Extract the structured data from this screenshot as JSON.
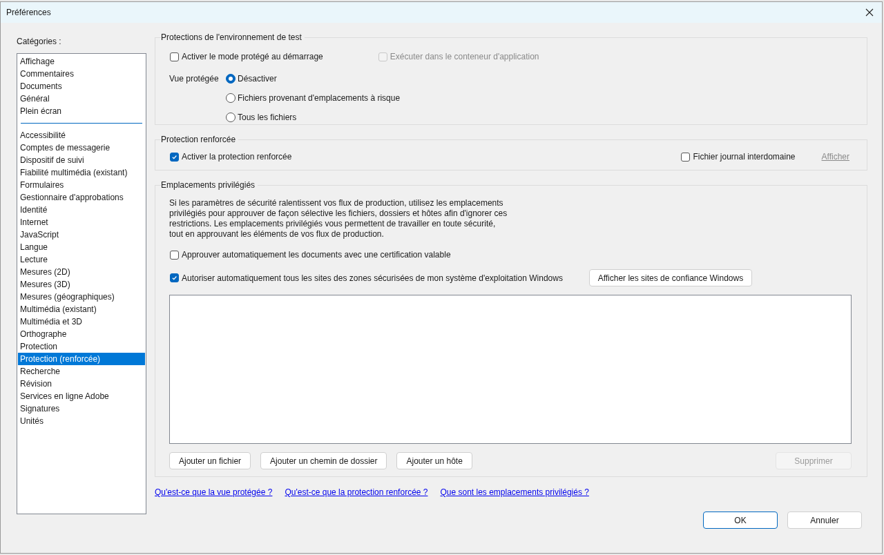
{
  "window": {
    "title": "Préférences"
  },
  "categories": {
    "label": "Catégories :",
    "groups": [
      [
        {
          "label": "Affichage",
          "selected": false
        },
        {
          "label": "Commentaires",
          "selected": false
        },
        {
          "label": "Documents",
          "selected": false
        },
        {
          "label": "Général",
          "selected": false
        },
        {
          "label": "Plein écran",
          "selected": false
        }
      ],
      [
        {
          "label": "Accessibilité",
          "selected": false
        },
        {
          "label": "Comptes de messagerie",
          "selected": false
        },
        {
          "label": "Dispositif de suivi",
          "selected": false
        },
        {
          "label": "Fiabilité multimédia (existant)",
          "selected": false
        },
        {
          "label": "Formulaires",
          "selected": false
        },
        {
          "label": "Gestionnaire d'approbations",
          "selected": false
        },
        {
          "label": "Identité",
          "selected": false
        },
        {
          "label": "Internet",
          "selected": false
        },
        {
          "label": "JavaScript",
          "selected": false
        },
        {
          "label": "Langue",
          "selected": false
        },
        {
          "label": "Lecture",
          "selected": false
        },
        {
          "label": "Mesures (2D)",
          "selected": false
        },
        {
          "label": "Mesures (3D)",
          "selected": false
        },
        {
          "label": "Mesures (géographiques)",
          "selected": false
        },
        {
          "label": "Multimédia (existant)",
          "selected": false
        },
        {
          "label": "Multimédia et 3D",
          "selected": false
        },
        {
          "label": "Orthographe",
          "selected": false
        },
        {
          "label": "Protection",
          "selected": false
        },
        {
          "label": "Protection (renforcée)",
          "selected": true
        },
        {
          "label": "Recherche",
          "selected": false
        },
        {
          "label": "Révision",
          "selected": false
        },
        {
          "label": "Services en ligne Adobe",
          "selected": false
        },
        {
          "label": "Signatures",
          "selected": false
        },
        {
          "label": "Unités",
          "selected": false
        }
      ]
    ]
  },
  "sandbox": {
    "title": "Protections de l'environnement de test",
    "checkboxes": [
      {
        "label": "Activer le mode protégé au démarrage",
        "checked": false,
        "disabled": false
      },
      {
        "label": "Exécuter dans le conteneur d'application",
        "checked": false,
        "disabled": true
      }
    ],
    "radio_label": "Vue protégée",
    "radios": [
      {
        "label": "Désactiver",
        "selected": true
      },
      {
        "label": "Fichiers provenant d'emplacements à risque",
        "selected": false
      },
      {
        "label": "Tous les fichiers",
        "selected": false
      }
    ]
  },
  "enhanced": {
    "title": "Protection renforcée",
    "checkboxes": [
      {
        "label": "Activer la protection renforcée",
        "checked": true,
        "disabled": false
      },
      {
        "label": "Fichier journal interdomaine",
        "checked": false,
        "disabled": false
      }
    ],
    "link": {
      "label": "Afficher",
      "disabled": true
    }
  },
  "privileged": {
    "title": "Emplacements privilégiés",
    "description": "Si les paramètres de sécurité ralentissent vos flux de production, utilisez les emplacements privilégiés pour approuver de façon sélective les fichiers, dossiers et hôtes afin d'ignorer ces restrictions. Les emplacements privilégiés vous permettent de travailler en toute sécurité, tout en approuvant les éléments de vos flux de production.",
    "checkboxes": [
      {
        "label": "Approuver automatiquement les documents avec une certification valable",
        "checked": false,
        "disabled": false
      },
      {
        "label": "Autoriser automatiquement tous les sites des zones sécurisées de mon système d'exploitation Windows",
        "checked": true,
        "disabled": false
      }
    ],
    "trusted_sites_button": "Afficher les sites de confiance Windows",
    "buttons": [
      {
        "label": "Ajouter un fichier",
        "disabled": false
      },
      {
        "label": "Ajouter un chemin de dossier",
        "disabled": false
      },
      {
        "label": "Ajouter un hôte",
        "disabled": false
      }
    ],
    "remove_button": {
      "label": "Supprimer",
      "disabled": true
    }
  },
  "help_links": [
    "Qu'est-ce que la vue protégée ?",
    "Qu'est-ce que la protection renforcée ?",
    "Que sont les emplacements privilégiés ?"
  ],
  "footer_buttons": [
    {
      "label": "OK",
      "default": true
    },
    {
      "label": "Annuler",
      "default": false
    }
  ]
}
